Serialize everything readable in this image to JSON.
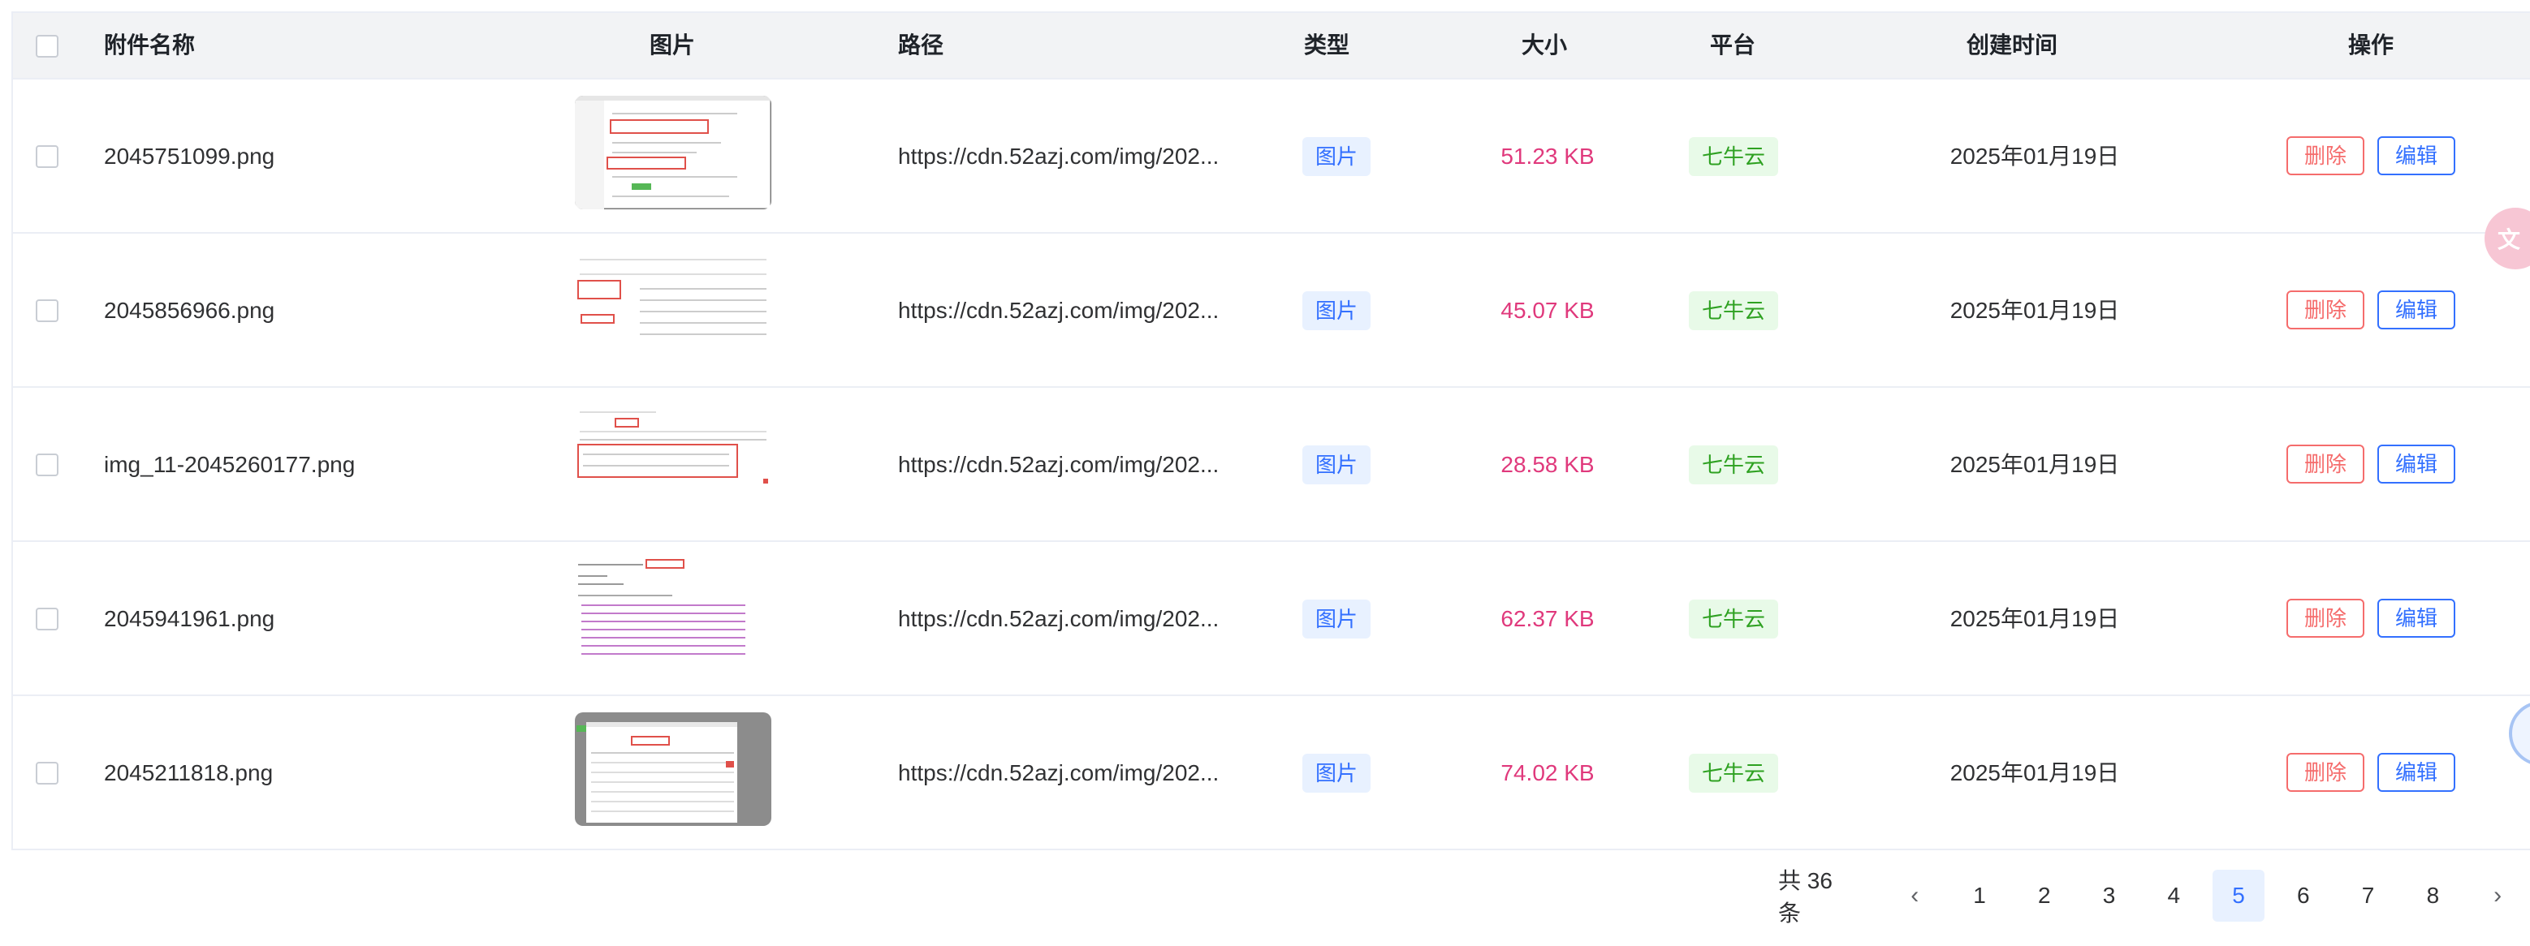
{
  "table": {
    "headers": {
      "name": "附件名称",
      "image": "图片",
      "path": "路径",
      "type": "类型",
      "size": "大小",
      "platform": "平台",
      "created": "创建时间",
      "actions": "操作"
    },
    "rows": [
      {
        "name": "2045751099.png",
        "path": "https://cdn.52azj.com/img/202...",
        "type": "图片",
        "size": "51.23 KB",
        "platform": "七牛云",
        "created": "2025年01月19日",
        "delete": "删除",
        "edit": "编辑"
      },
      {
        "name": "2045856966.png",
        "path": "https://cdn.52azj.com/img/202...",
        "type": "图片",
        "size": "45.07 KB",
        "platform": "七牛云",
        "created": "2025年01月19日",
        "delete": "删除",
        "edit": "编辑"
      },
      {
        "name": "img_11-2045260177.png",
        "path": "https://cdn.52azj.com/img/202...",
        "type": "图片",
        "size": "28.58 KB",
        "platform": "七牛云",
        "created": "2025年01月19日",
        "delete": "删除",
        "edit": "编辑"
      },
      {
        "name": "2045941961.png",
        "path": "https://cdn.52azj.com/img/202...",
        "type": "图片",
        "size": "62.37 KB",
        "platform": "七牛云",
        "created": "2025年01月19日",
        "delete": "删除",
        "edit": "编辑"
      },
      {
        "name": "2045211818.png",
        "path": "https://cdn.52azj.com/img/202...",
        "type": "图片",
        "size": "74.02 KB",
        "platform": "七牛云",
        "created": "2025年01月19日",
        "delete": "删除",
        "edit": "编辑"
      }
    ]
  },
  "pagination": {
    "total": "共 36 条",
    "pages": [
      "1",
      "2",
      "3",
      "4",
      "5",
      "6",
      "7",
      "8"
    ],
    "current": "5",
    "prev_icon": "chevron-left-icon",
    "next_icon": "chevron-right-icon"
  },
  "floating": {
    "translate_icon": "translate-icon",
    "assistant_icon": "assistant-ball-icon"
  },
  "colors": {
    "header_bg": "#f2f3f5",
    "primary": "#3370ff",
    "danger": "#f56c6c",
    "size_text": "#e0397c",
    "success_tag_bg": "#e8fae8",
    "success_tag_text": "#2ea121"
  }
}
